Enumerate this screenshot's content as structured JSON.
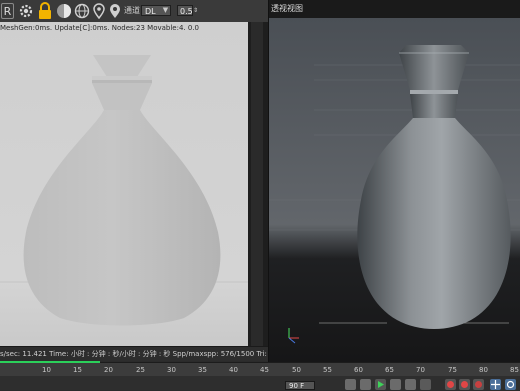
{
  "toolbar": {
    "r_label": "R",
    "channel_label": "通道",
    "channel_value": "DL",
    "spin_value": "0.5"
  },
  "render_panel": {
    "status": "MeshGen:0ms. Update[C]:0ms. Nodes:23 Movable:4. 0.0",
    "stats": "s/sec: 11.421   Time: 小时 : 分钟 : 秒/小时 : 分钟 : 秒   Spp/maxspp: 576/1500   Tri: 0/29k   Mesh: 6        Hair: 0"
  },
  "viewport": {
    "title": "透视视图"
  },
  "timeline": {
    "ticks": [
      "10",
      "15",
      "20",
      "25",
      "30",
      "35",
      "40",
      "45",
      "50",
      "55",
      "60",
      "65",
      "70",
      "75",
      "80",
      "85"
    ]
  },
  "transport": {
    "frame": "90 F"
  },
  "colors": {
    "render_bg": "#d2d2d2",
    "viewport_bg": "#555a5f",
    "accent_progress": "#2bd05a"
  }
}
